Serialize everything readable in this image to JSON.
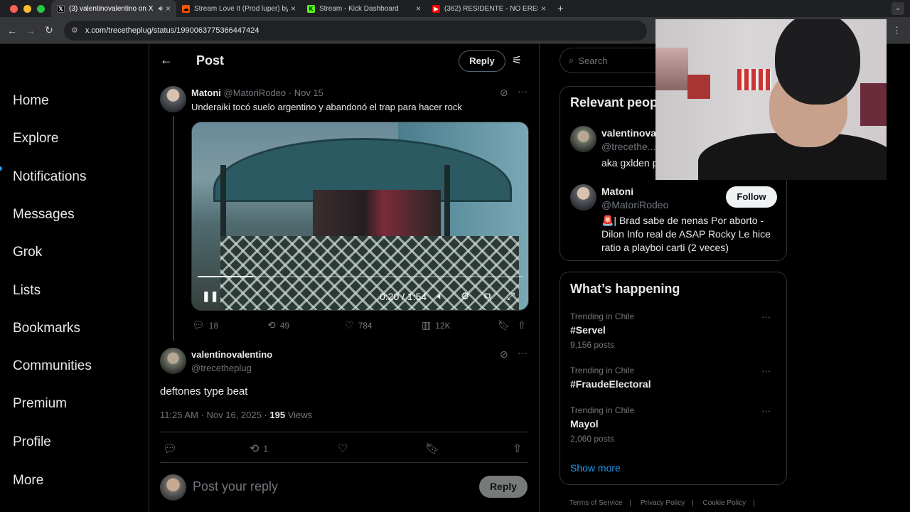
{
  "browser": {
    "tabs": [
      {
        "title": "(3) valentinovalentino on X",
        "icon": "x-logo-icon",
        "active": true
      },
      {
        "title": "Stream Love It (Prod luper) by",
        "icon": "soundcloud-icon",
        "active": false
      },
      {
        "title": "Stream - Kick Dashboard",
        "icon": "kick-icon",
        "active": false
      },
      {
        "title": "(362) RESIDENTE - NO ERES",
        "icon": "youtube-icon",
        "active": false
      }
    ],
    "url": "x.com/trecetheplug/status/1990063775366447424"
  },
  "nav": {
    "items": [
      "Home",
      "Explore",
      "Notifications",
      "Messages",
      "Grok",
      "Lists",
      "Bookmarks",
      "Communities",
      "Premium",
      "Profile",
      "More"
    ]
  },
  "header": {
    "title": "Post",
    "reply_button": "Reply"
  },
  "quoted": {
    "name": "Matoni",
    "handle": "@MatoriRodeo",
    "date": "Nov 15",
    "text": "Underaiki tocó suelo argentino y abandonó el trap para hacer rock",
    "video_time": "0:20 / 1:54",
    "video_progress": 0.17,
    "stats": {
      "replies": "18",
      "reposts": "49",
      "likes": "784",
      "views": "12K"
    }
  },
  "post": {
    "name": "valentinovalentino",
    "handle": "@trecetheplug",
    "text": "deftones type beat",
    "time": "11:25 AM · Nov 16, 2025 · ",
    "views": "195",
    "views_label": " Views",
    "reposts": "1"
  },
  "reply_box": {
    "placeholder": "Post your reply",
    "button": "Reply"
  },
  "sidebar": {
    "search_placeholder": "Search",
    "relevant_title": "Relevant peop",
    "people": [
      {
        "name": "valentinova",
        "handle": "@trecethe...",
        "bio": "aka gxlden p"
      },
      {
        "name": "Matoni",
        "handle": "@MatoriRodeo",
        "follow": "Follow",
        "bio": "🚨| Brad sabe de nenas Por aborto - Dilon Info real de ASAP Rocky Le hice ratio a playboi carti (2 veces)"
      }
    ],
    "happening_title": "What’s happening",
    "trends": [
      {
        "context": "Trending in Chile",
        "tag": "#Servel",
        "count": "9,156 posts"
      },
      {
        "context": "Trending in Chile",
        "tag": "#FraudeElectoral",
        "count": ""
      },
      {
        "context": "Trending in Chile",
        "tag": "Mayol",
        "count": "2,060 posts"
      }
    ],
    "show_more": "Show more",
    "footer": [
      "Terms of Service",
      "|",
      "Privacy Policy",
      "|",
      "Cookie Policy",
      "|"
    ]
  }
}
